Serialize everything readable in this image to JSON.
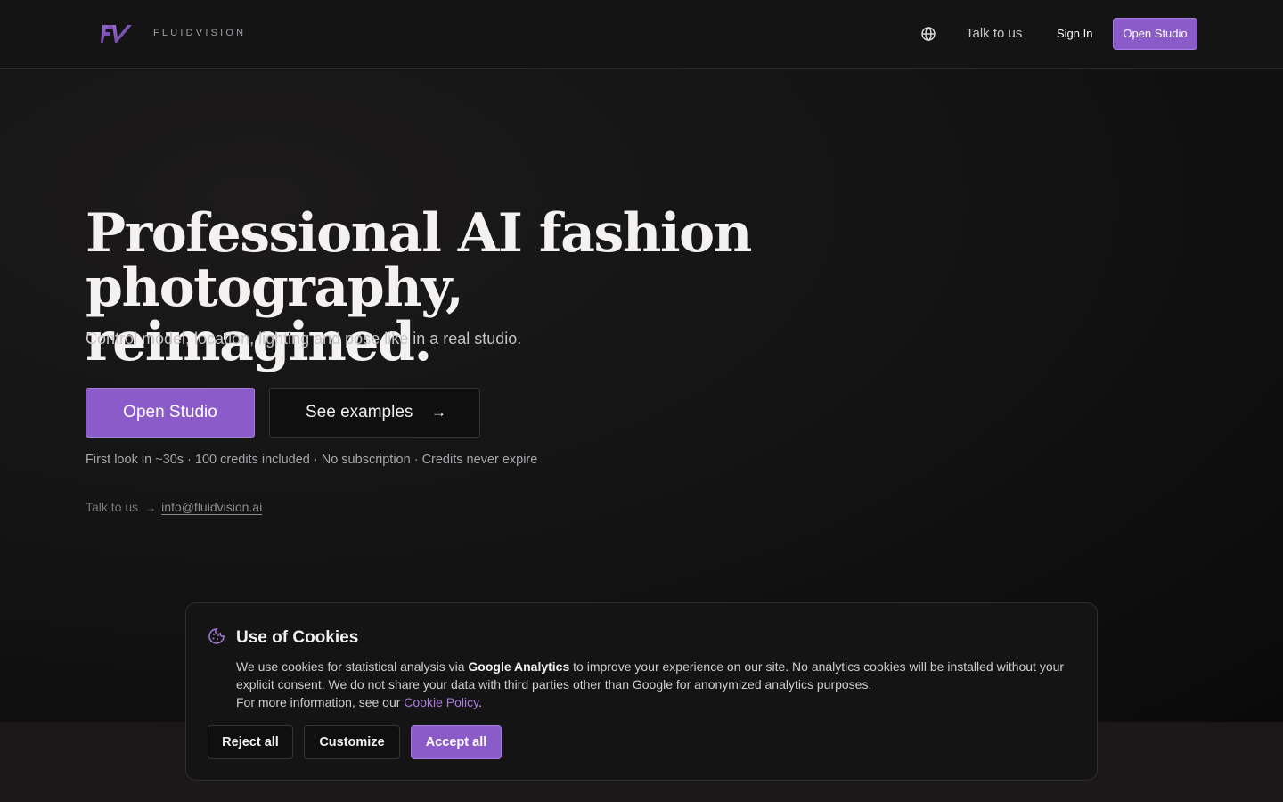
{
  "header": {
    "brand": "FLUIDVISION",
    "talk_label": "Talk to us",
    "signin_label": "Sign In",
    "open_studio_label": "Open Studio",
    "logo_icon": "fv-logo-icon",
    "language_icon": "globe-icon"
  },
  "hero": {
    "headline_line1": "Professional AI fashion",
    "headline_line2": "photography, reimagined.",
    "subhead": "Control model, location, lighting and pose like in a real studio.",
    "primary_cta": "Open Studio",
    "secondary_cta": "See examples",
    "secondary_cta_icon": "arrow-right-icon",
    "features": "First look in ~30s · 100 credits included · No subscription · Credits never expire",
    "contact_label": "Talk to us",
    "contact_arrow": "→",
    "contact_email": "info@fluidvision.ai"
  },
  "cookie_banner": {
    "icon": "cookie-icon",
    "title": "Use of Cookies",
    "text_before": "We use cookies for statistical analysis via ",
    "text_bold": "Google Analytics",
    "text_after": " to improve your experience on our site. No analytics cookies will be installed without your explicit consent. We do not share your data with third parties other than Google for anonymized analytics purposes.",
    "more_info_prefix": "For more information, see our ",
    "policy_link": "Cookie Policy",
    "more_info_suffix": ".",
    "reject_label": "Reject all",
    "customize_label": "Customize",
    "accept_label": "Accept all"
  },
  "colors": {
    "accent": "#8b5bc9",
    "accent_link": "#a77bde",
    "background": "#0d0d0d",
    "surface": "#151414"
  }
}
